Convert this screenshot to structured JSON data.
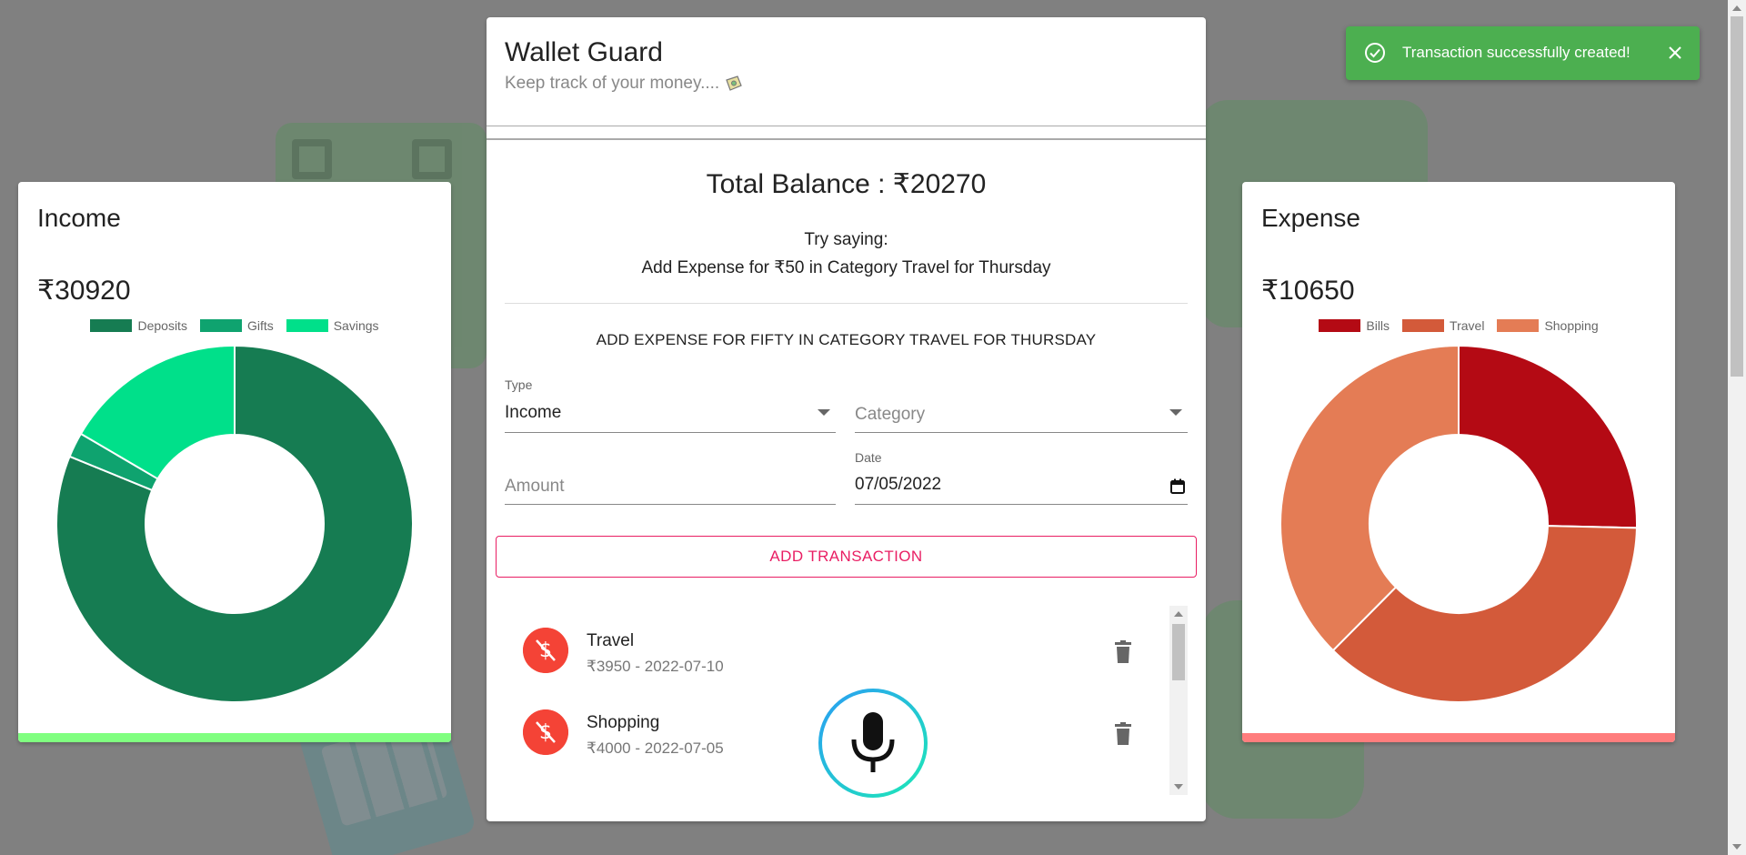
{
  "app": {
    "title": "Wallet Guard",
    "subtitle": "Keep track of your money....",
    "subtitle_icon": "money-bag-icon"
  },
  "balance": {
    "label": "Total Balance : ₹20270"
  },
  "hint": {
    "line1": "Try saying:",
    "line2": "Add Expense for ₹50 in Category Travel for Thursday"
  },
  "speech": {
    "transcript": "ADD EXPENSE FOR FIFTY IN CATEGORY TRAVEL FOR THURSDAY"
  },
  "form": {
    "type_label": "Type",
    "type_value": "Income",
    "category_placeholder": "Category",
    "amount_placeholder": "Amount",
    "date_label": "Date",
    "date_value": "07/05/2022",
    "submit_label": "ADD TRANSACTION"
  },
  "transactions": [
    {
      "title": "Travel",
      "detail": "₹3950 - 2022-07-10",
      "icon": "money-off-icon"
    },
    {
      "title": "Shopping",
      "detail": "₹4000 - 2022-07-05",
      "icon": "money-off-icon"
    }
  ],
  "income": {
    "title": "Income",
    "total": "₹30920",
    "accent": "#80ff80",
    "chart_data": {
      "type": "pie",
      "categories": [
        "Deposits",
        "Gifts",
        "Savings"
      ],
      "values": [
        25100,
        700,
        5120
      ],
      "colors": [
        "#167c52",
        "#0fa36f",
        "#00e08a"
      ]
    }
  },
  "expense": {
    "title": "Expense",
    "total": "₹10650",
    "accent": "#ff7d7d",
    "chart_data": {
      "type": "pie",
      "categories": [
        "Bills",
        "Travel",
        "Shopping"
      ],
      "values": [
        2700,
        3950,
        4000
      ],
      "colors": [
        "#b40a14",
        "#d35a3a",
        "#e47c55"
      ]
    }
  },
  "toast": {
    "message": "Transaction successfully created!",
    "color": "#4caf50"
  }
}
